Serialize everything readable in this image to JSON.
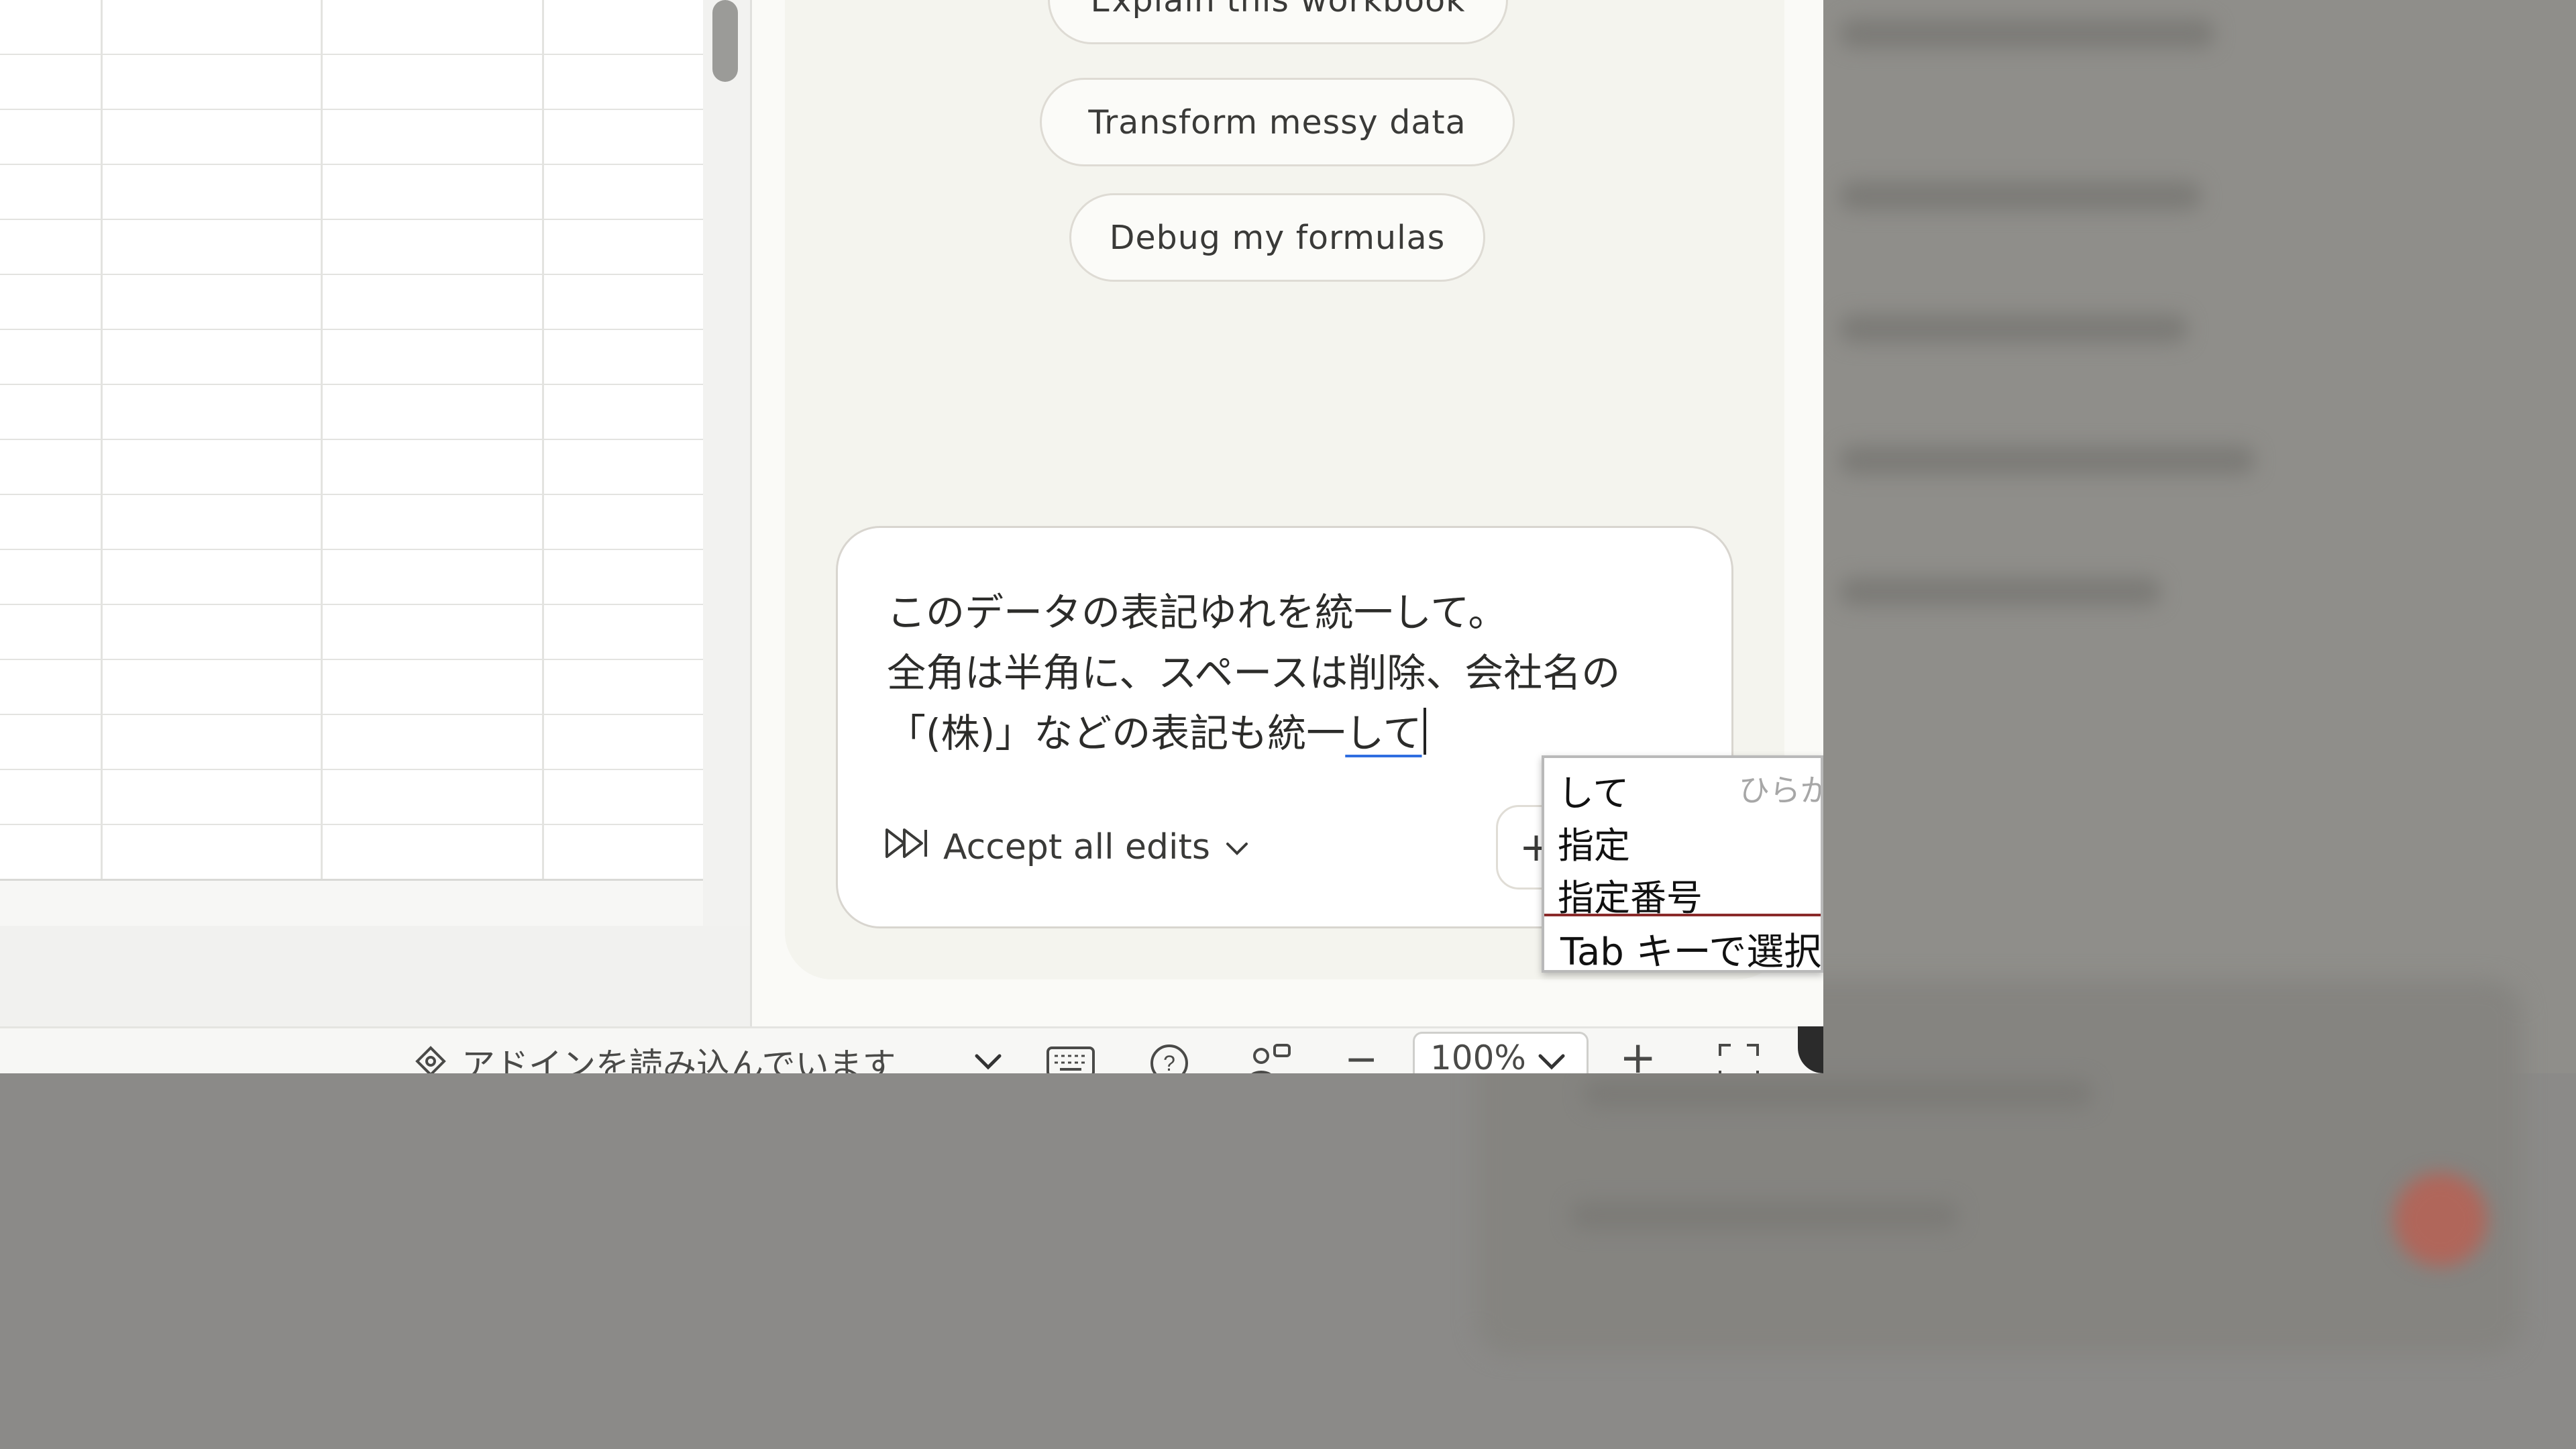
{
  "assistant": {
    "suggestions": [
      {
        "label": "Explain this workbook"
      },
      {
        "label": "Transform messy data"
      },
      {
        "label": "Debug my formulas"
      }
    ],
    "prompt": {
      "line1": "このデータの表記ゆれを統一して。",
      "line2": "全角は半角に、スペースは削除、会社名の",
      "line3_committed": "「(株)」などの表記も統一",
      "line3_composing": "して"
    },
    "accept_all_edits": "Accept all edits",
    "plus_symbol": "+"
  },
  "ime": {
    "mode": "ひらが",
    "candidates": [
      "して",
      "指定",
      "指定番号"
    ],
    "hint": "Tab キーで選択"
  },
  "statusbar": {
    "addin_status": "アドインを読み込んでいます",
    "zoom": "100%",
    "zoom_out": "−",
    "zoom_in": "+"
  }
}
